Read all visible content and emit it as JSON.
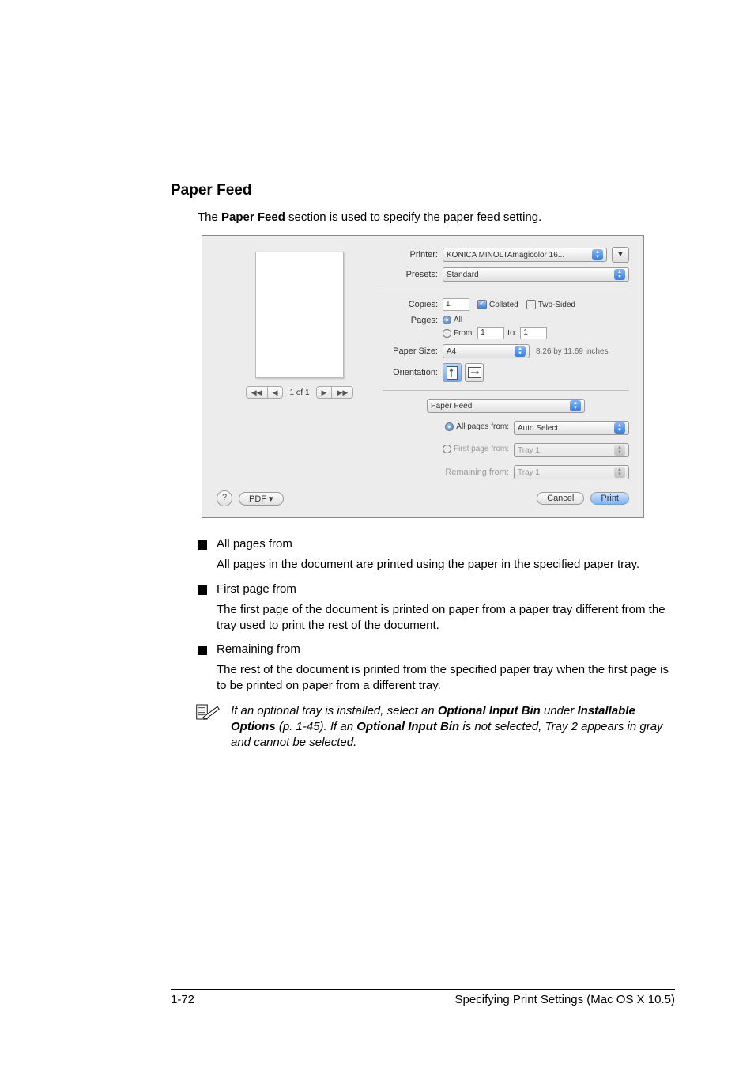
{
  "heading": "Paper Feed",
  "intro_pre": "The ",
  "intro_bold": "Paper Feed",
  "intro_post": " section is used to specify the paper feed setting.",
  "dialog": {
    "printer_label": "Printer:",
    "printer_value": "KONICA MINOLTAmagicolor 16...",
    "presets_label": "Presets:",
    "presets_value": "Standard",
    "copies_label": "Copies:",
    "copies_value": "1",
    "collated": "Collated",
    "two_sided": "Two-Sided",
    "pages_label": "Pages:",
    "pages_all": "All",
    "pages_from": "From:",
    "pages_from_value": "1",
    "pages_to": "to:",
    "pages_to_value": "1",
    "papersize_label": "Paper Size:",
    "papersize_value": "A4",
    "papersize_dim": "8.26 by 11.69 inches",
    "orientation_label": "Orientation:",
    "section_popup": "Paper Feed",
    "all_pages_from": "All pages from:",
    "all_pages_value": "Auto Select",
    "first_page_from": "First page from:",
    "first_page_value": "Tray 1",
    "remaining_from": "Remaining from:",
    "remaining_value": "Tray 1",
    "page_indicator": "1 of 1",
    "help": "?",
    "pdf": "PDF ▾",
    "cancel": "Cancel",
    "print": "Print"
  },
  "bullets": [
    {
      "title": "All pages from",
      "desc": "All pages in the document are printed using the paper in the specified paper tray."
    },
    {
      "title": "First page from",
      "desc": "The first page of the document is printed on paper from a paper tray different from the tray used to print the rest of the document."
    },
    {
      "title": "Remaining from",
      "desc": "The rest of the document is printed from the specified paper tray when the first page is to be printed on paper from a different tray."
    }
  ],
  "note_pre": "If an optional tray is installed, select an ",
  "note_b1": "Optional Input Bin",
  "note_mid1": " under ",
  "note_b2": "Installable Options",
  "note_mid2": " (p. 1-45). If an ",
  "note_b3": "Optional Input Bin",
  "note_post": " is not selected, Tray 2 appears in gray and cannot be selected.",
  "footer_left": "1-72",
  "footer_right": "Specifying Print Settings (Mac OS X 10.5)"
}
